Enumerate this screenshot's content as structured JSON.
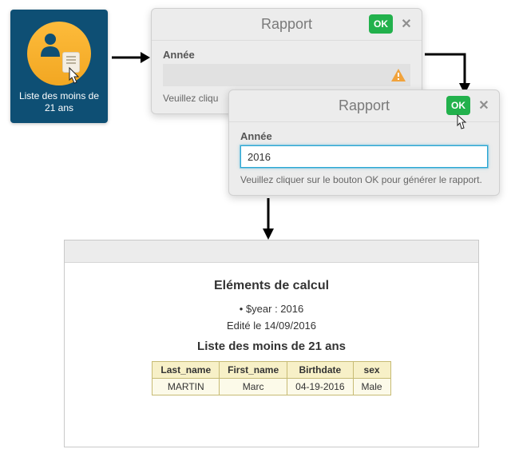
{
  "tile": {
    "label": "Liste des moins de 21 ans"
  },
  "dialog1": {
    "title": "Rapport",
    "ok": "OK",
    "field_label": "Année",
    "hint": "Veuillez cliqu"
  },
  "dialog2": {
    "title": "Rapport",
    "ok": "OK",
    "field_label": "Année",
    "value": "2016",
    "hint": "Veuillez cliquer sur le bouton OK pour générer le rapport."
  },
  "report": {
    "heading": "Eléments de calcul",
    "param_line": "• $year : 2016",
    "edited_line": "Edité le 14/09/2016",
    "subheading": "Liste des moins de 21 ans",
    "cols": {
      "c0": "Last_name",
      "c1": "First_name",
      "c2": "Birthdate",
      "c3": "sex"
    },
    "row": {
      "c0": "MARTIN",
      "c1": "Marc",
      "c2": "04-19-2016",
      "c3": "Male"
    }
  }
}
